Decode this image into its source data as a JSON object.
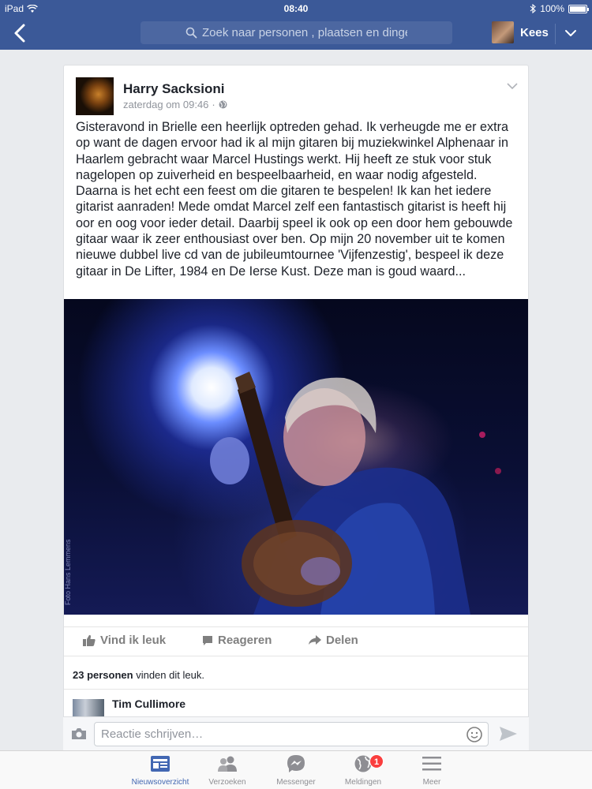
{
  "status_bar": {
    "device": "iPad",
    "time": "08:40",
    "battery": "100%"
  },
  "nav": {
    "search_placeholder": "Zoek naar personen , plaatsen en dingen",
    "user_name": "Kees"
  },
  "post": {
    "author": "Harry Sacksioni",
    "timestamp": "zaterdag om 09:46",
    "separator": "·",
    "text": "Gisteravond in Brielle een heerlijk optreden gehad. Ik verheugde me er extra op want de dagen ervoor had ik al mijn gitaren bij muziekwinkel Alphenaar in Haarlem  gebracht waar Marcel Hustings werkt. Hij heeft ze stuk voor stuk nagelopen op zuiverheid en bespeelbaarheid, en waar nodig afgesteld. Daarna is het echt een feest om die gitaren te bespelen! Ik kan het iedere gitarist aanraden! Mede omdat Marcel zelf een fantastisch gitarist is heeft hij oor en oog voor ieder detail. Daarbij speel ik ook op een door hem gebouwde gitaar waar ik zeer enthousiast  over ben. Op mijn 20 november uit te komen nieuwe dubbel live cd van de jubileumtournee 'Vijfenzestig', bespeel ik deze gitaar in De Lifter, 1984 en De Ierse Kust. Deze man is goud waard...",
    "photo_credit": "Foto Hans Lemmens",
    "actions": {
      "like": "Vind ik leuk",
      "comment": "Reageren",
      "share": "Delen"
    },
    "likes_count": "23 personen",
    "likes_suffix": " vinden dit leuk.",
    "comment_author": "Tim Cullimore"
  },
  "composer": {
    "placeholder": "Reactie schrijven…"
  },
  "tabs": [
    {
      "label": "Nieuwsoverzicht",
      "icon": "news-feed-icon",
      "active": true
    },
    {
      "label": "Verzoeken",
      "icon": "friend-requests-icon"
    },
    {
      "label": "Messenger",
      "icon": "messenger-icon"
    },
    {
      "label": "Meldingen",
      "icon": "globe-notifications-icon"
    },
    {
      "label": "Meer",
      "icon": "menu-icon"
    }
  ],
  "notifications_badge": "1",
  "colors": {
    "brand": "#3b5998",
    "search_bg": "#4c67a1",
    "active_tab": "#4267b2",
    "badge": "#fa3e3e"
  }
}
